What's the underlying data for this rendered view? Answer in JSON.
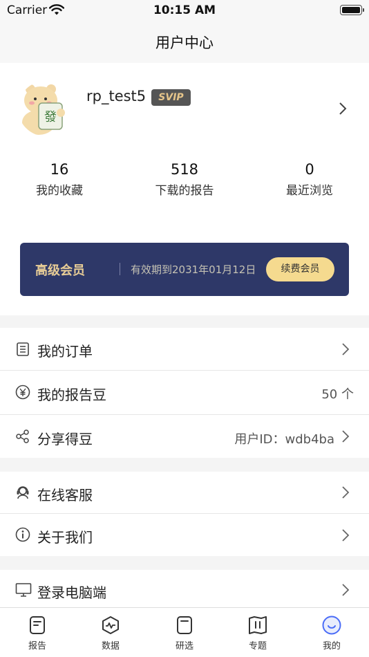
{
  "status_bar": {
    "carrier": "Carrier",
    "time": "10:15 AM"
  },
  "nav": {
    "title": "用户中心"
  },
  "profile": {
    "username": "rp_test5",
    "badge": "SVIP",
    "stats": [
      {
        "value": "16",
        "label": "我的收藏"
      },
      {
        "value": "518",
        "label": "下载的报告"
      },
      {
        "value": "0",
        "label": "最近浏览"
      }
    ]
  },
  "vip_card": {
    "title": "高级会员",
    "expiry": "有效期到2031年01月12日",
    "renew_label": "续费会员"
  },
  "menu": {
    "orders": {
      "label": "我的订单",
      "icon": "list-icon"
    },
    "beans": {
      "label": "我的报告豆",
      "value": "50 个",
      "icon": "yen-icon"
    },
    "share": {
      "label": "分享得豆",
      "value": "用户ID：wdb4ba",
      "icon": "share-icon"
    },
    "support": {
      "label": "在线客服",
      "icon": "headset-icon"
    },
    "about": {
      "label": "关于我们",
      "icon": "info-icon"
    },
    "desktop": {
      "label": "登录电脑端",
      "icon": "monitor-icon"
    }
  },
  "tabs": [
    {
      "label": "报告",
      "icon": "report-icon"
    },
    {
      "label": "数据",
      "icon": "data-icon"
    },
    {
      "label": "研选",
      "icon": "research-icon"
    },
    {
      "label": "专题",
      "icon": "topic-icon"
    },
    {
      "label": "我的",
      "icon": "me-icon",
      "active": true
    }
  ],
  "colors": {
    "vip_card_bg": "#2e3868",
    "vip_gold": "#e8cd96",
    "renew_button": "#f5da8f",
    "active_tab": "#4a6cf7"
  }
}
